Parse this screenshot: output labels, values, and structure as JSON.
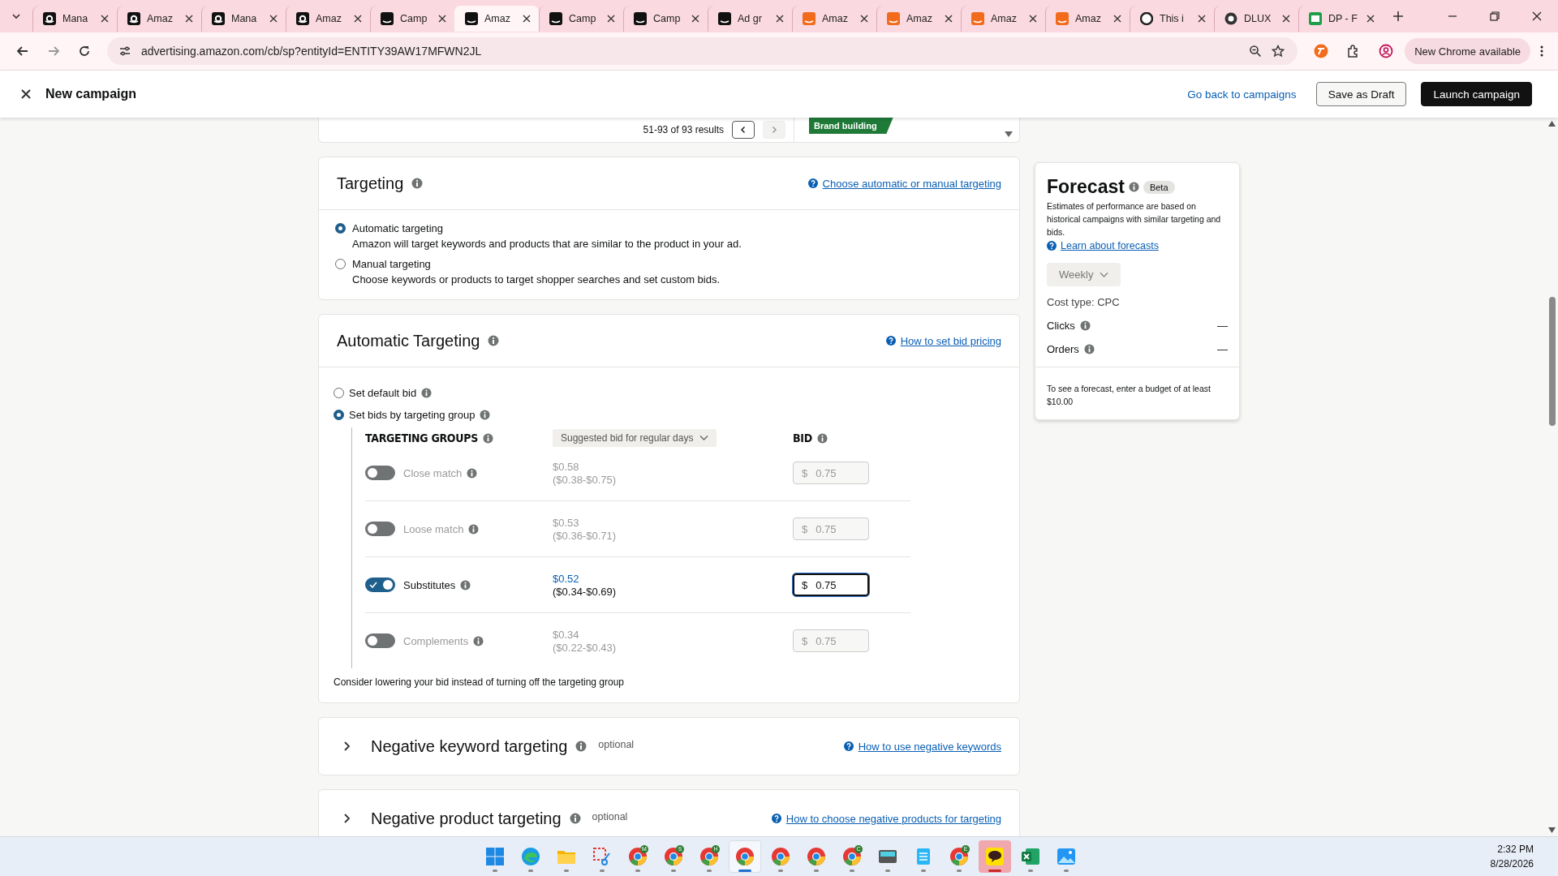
{
  "browser": {
    "tabs": [
      {
        "title": "Mana",
        "kind": "a",
        "selected": false
      },
      {
        "title": "Amaz",
        "kind": "a",
        "selected": false
      },
      {
        "title": "Mana",
        "kind": "a",
        "selected": false
      },
      {
        "title": "Amaz",
        "kind": "a",
        "selected": false
      },
      {
        "title": "Camp",
        "kind": "smile",
        "selected": false
      },
      {
        "title": "Amaz",
        "kind": "smile",
        "selected": true
      },
      {
        "title": "Camp",
        "kind": "smile",
        "selected": false
      },
      {
        "title": "Camp",
        "kind": "smile",
        "selected": false
      },
      {
        "title": "Ad gr",
        "kind": "smile",
        "selected": false
      },
      {
        "title": "Amaz",
        "kind": "orange",
        "selected": false
      },
      {
        "title": "Amaz",
        "kind": "orange",
        "selected": false
      },
      {
        "title": "Amaz",
        "kind": "orange",
        "selected": false
      },
      {
        "title": "Amaz",
        "kind": "orange",
        "selected": false
      },
      {
        "title": "This i",
        "kind": "ring",
        "selected": false
      },
      {
        "title": "DLUX",
        "kind": "dark",
        "selected": false
      },
      {
        "title": "DP - F",
        "kind": "green",
        "selected": false
      }
    ],
    "url": "advertising.amazon.com/cb/sp?entityId=ENTITY39AW17MFWN2JL",
    "update_label": "New Chrome available"
  },
  "header": {
    "title": "New campaign",
    "back_link": "Go back to campaigns",
    "buttons": [
      {
        "label": "Save as Draft",
        "kind": "secondary"
      },
      {
        "label": "Launch campaign",
        "kind": "primary"
      }
    ]
  },
  "results": {
    "range": "51-93 of 93 results",
    "tag": "Brand building"
  },
  "targeting": {
    "title": "Targeting",
    "help_link": "Choose automatic or manual targeting",
    "options": [
      {
        "label": "Automatic targeting",
        "description": "Amazon will target keywords and products that are similar to the product in your ad.",
        "selected": true
      },
      {
        "label": "Manual targeting",
        "description": "Choose keywords or products to target shopper searches and set custom bids.",
        "selected": false
      }
    ]
  },
  "automatic_targeting": {
    "title": "Automatic Targeting",
    "help_link": "How to set bid pricing",
    "bid_options": [
      {
        "label": "Set default bid",
        "selected": false
      },
      {
        "label": "Set bids by targeting group",
        "selected": true
      }
    ],
    "groups_heading": "TARGETING GROUPS",
    "bid_dropdown": "Suggested bid for regular days",
    "bid_heading": "BID",
    "groups": [
      {
        "name": "Close match",
        "on": false,
        "suggested": "$0.58",
        "range": "($0.38-$0.75)",
        "currency": "$",
        "bid": "0.75",
        "focused": false
      },
      {
        "name": "Loose match",
        "on": false,
        "suggested": "$0.53",
        "range": "($0.36-$0.71)",
        "currency": "$",
        "bid": "0.75",
        "focused": false
      },
      {
        "name": "Substitutes",
        "on": true,
        "suggested": "$0.52",
        "range": "($0.34-$0.69)",
        "currency": "$",
        "bid": "0.75",
        "focused": true
      },
      {
        "name": "Complements",
        "on": false,
        "suggested": "$0.34",
        "range": "($0.22-$0.43)",
        "currency": "$",
        "bid": "0.75",
        "focused": false
      }
    ],
    "note": "Consider lowering your bid instead of turning off the targeting group"
  },
  "collapsed_sections": [
    {
      "title": "Negative keyword targeting",
      "badge": "optional",
      "help_link": "How to use negative keywords"
    },
    {
      "title": "Negative product targeting",
      "badge": "optional",
      "help_link": "How to choose negative products for targeting"
    }
  ],
  "forecast": {
    "title": "Forecast",
    "badge": "Beta",
    "description": "Estimates of performance are based on historical campaigns with similar targeting and bids.",
    "link": "Learn about forecasts",
    "period": "Weekly",
    "cost_type": "Cost type: CPC",
    "metrics": [
      {
        "label": "Clicks",
        "value": "—"
      },
      {
        "label": "Orders",
        "value": "—"
      }
    ],
    "note": "To see a forecast, enter a budget of at least $10.00"
  },
  "taskbar": {
    "apps": [
      {
        "kind": "start",
        "selected": false,
        "attention": false
      },
      {
        "kind": "edge",
        "selected": false,
        "attention": false
      },
      {
        "kind": "folder",
        "selected": false,
        "attention": false
      },
      {
        "kind": "snip",
        "selected": false,
        "attention": false
      },
      {
        "kind": "chrome",
        "badge": "M",
        "selected": false,
        "attention": false
      },
      {
        "kind": "chrome",
        "badge": "S",
        "selected": false,
        "attention": false
      },
      {
        "kind": "chrome",
        "badge": "H",
        "selected": false,
        "attention": false
      },
      {
        "kind": "chrome",
        "selected": true,
        "attention": false
      },
      {
        "kind": "chrome",
        "selected": false,
        "attention": false
      },
      {
        "kind": "chrome",
        "selected": false,
        "attention": false
      },
      {
        "kind": "chrome",
        "badge": "C",
        "selected": false,
        "attention": false
      },
      {
        "kind": "keyboard",
        "selected": false,
        "attention": false
      },
      {
        "kind": "notepad",
        "selected": false,
        "attention": false
      },
      {
        "kind": "chrome",
        "badge": "E",
        "selected": false,
        "attention": false
      },
      {
        "kind": "chat",
        "selected": false,
        "attention": true
      },
      {
        "kind": "sheet",
        "selected": false,
        "attention": false
      },
      {
        "kind": "photos",
        "selected": false,
        "attention": false
      }
    ],
    "time": "2:32 PM",
    "date": "8/28/2026"
  }
}
